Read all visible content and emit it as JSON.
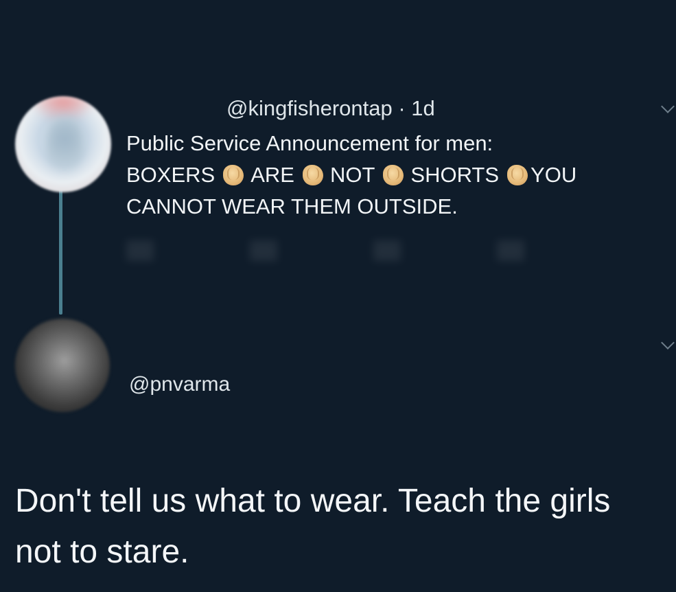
{
  "tweet": {
    "handle": "@kingfisherontap",
    "time": "· 1d",
    "line1": "Public Service Announcement for men:",
    "words": [
      "BOXERS",
      "ARE",
      "NOT",
      "SHORTS",
      "YOU"
    ],
    "line3": "CANNOT WEAR THEM OUTSIDE.",
    "clap_icon": "clapping-hands-emoji"
  },
  "reply": {
    "handle": "@pnvarma",
    "text": "Don't tell us what to wear. Teach the girls not to stare."
  }
}
